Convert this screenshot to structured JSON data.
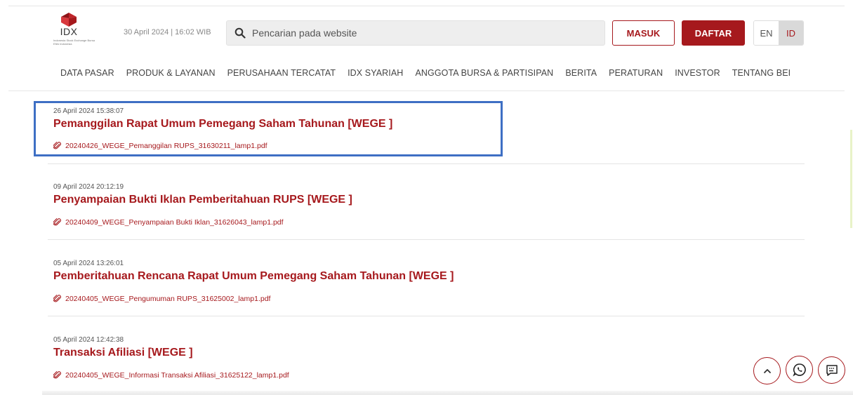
{
  "brand": {
    "logo_text": "IDX",
    "logo_tagline": "Indonesia Stock Exchange Bursa Efek Indonesia",
    "accent_color": "#a6191d"
  },
  "header": {
    "datetime": "30 April 2024  |  16:02 WIB",
    "search_placeholder": "Pencarian pada website",
    "login_label": "MASUK",
    "register_label": "DAFTAR",
    "lang_en": "EN",
    "lang_id": "ID",
    "active_lang": "ID"
  },
  "nav": {
    "items": [
      "DATA PASAR",
      "PRODUK & LAYANAN",
      "PERUSAHAAN TERCATAT",
      "IDX SYARIAH",
      "ANGGOTA BURSA & PARTISIPAN",
      "BERITA",
      "PERATURAN",
      "INVESTOR",
      "TENTANG BEI"
    ]
  },
  "announcements": [
    {
      "date": "26 April 2024 15:38:07",
      "title": "Pemanggilan Rapat Umum Pemegang Saham Tahunan [WEGE ]",
      "attachment": "20240426_WEGE_Pemanggilan RUPS_31630211_lamp1.pdf"
    },
    {
      "date": "09 April 2024 20:12:19",
      "title": "Penyampaian Bukti Iklan Pemberitahuan RUPS [WEGE ]",
      "attachment": "20240409_WEGE_Penyampaian Bukti Iklan_31626043_lamp1.pdf"
    },
    {
      "date": "05 April 2024 13:26:01",
      "title": "Pemberitahuan Rencana Rapat Umum Pemegang Saham Tahunan [WEGE ]",
      "attachment": "20240405_WEGE_Pengumuman RUPS_31625002_lamp1.pdf"
    },
    {
      "date": "05 April 2024 12:42:38",
      "title": "Transaksi Afiliasi [WEGE ]",
      "attachment": "20240405_WEGE_Informasi Transaksi Afiliasi_31625122_lamp1.pdf"
    }
  ],
  "floating_buttons": {
    "scroll_top_icon": "chevron-up-icon",
    "whatsapp_icon": "whatsapp-icon",
    "chat_icon": "chat-icon"
  }
}
